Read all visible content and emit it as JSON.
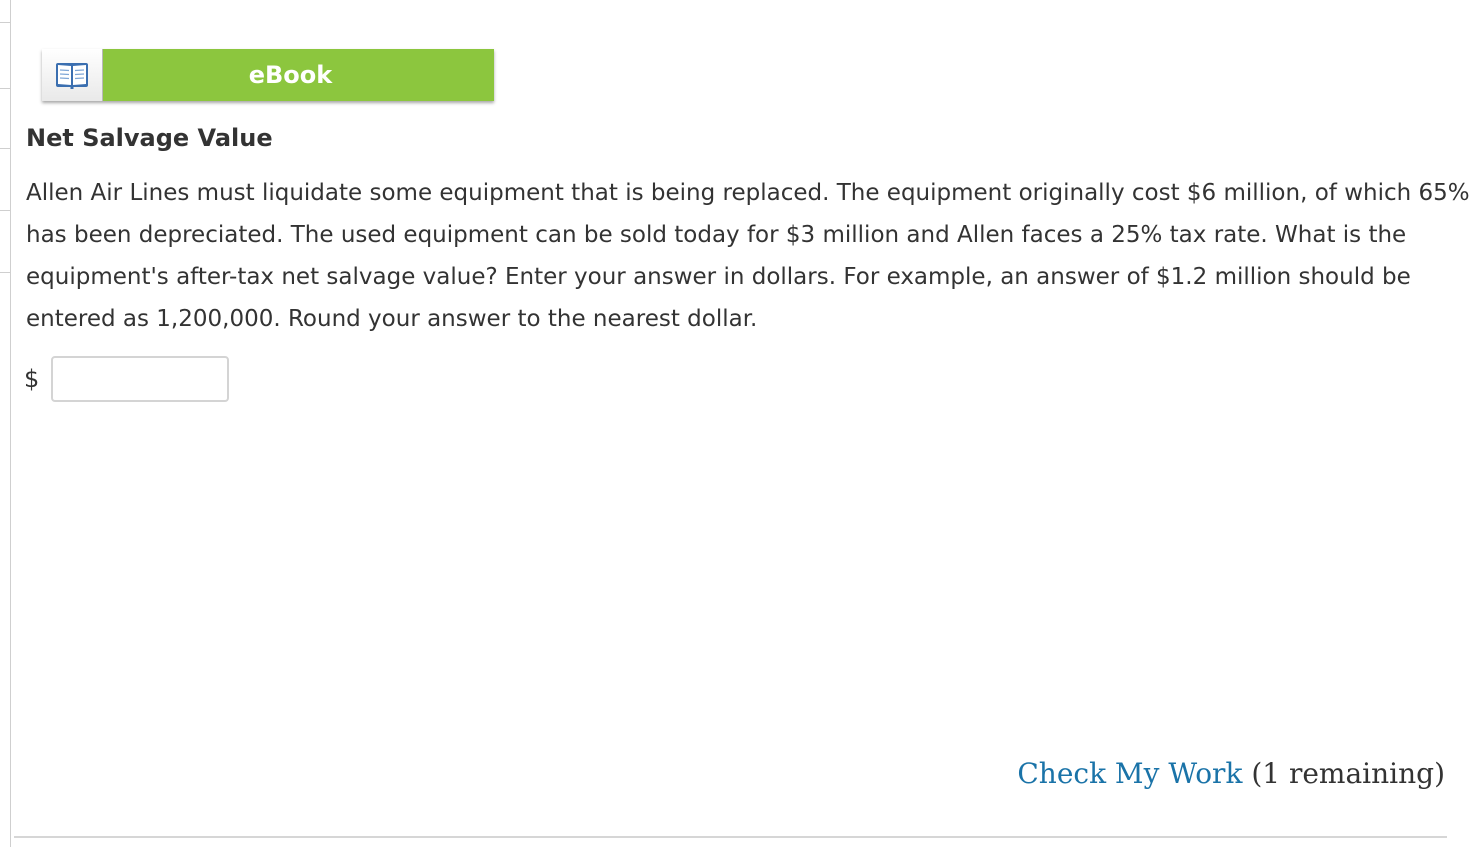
{
  "ebook": {
    "label": "eBook",
    "icon": "open-book-icon"
  },
  "question": {
    "title": "Net Salvage Value",
    "body": "Allen Air Lines must liquidate some equipment that is being replaced. The equipment originally cost $6 million, of which 65% has been depreciated. The used equipment can be sold today for $3 million and Allen faces a 25% tax rate. What is the equipment's after-tax net salvage value? Enter your answer in dollars. For example, an answer of $1.2 million should be entered as 1,200,000. Round your answer to the nearest dollar."
  },
  "answer": {
    "currency_symbol": "$",
    "value": "",
    "placeholder": ""
  },
  "check": {
    "link_label": "Check My Work",
    "remaining_text": "(1 remaining)"
  },
  "colors": {
    "ebook_green": "#8cc63e",
    "link_blue": "#1a73a8",
    "text": "#333333"
  }
}
